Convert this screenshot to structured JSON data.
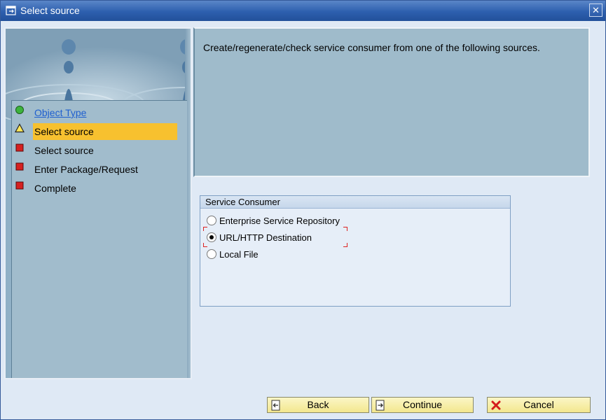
{
  "window": {
    "title": "Select source",
    "close_glyph": "✕"
  },
  "roadmap": {
    "steps": [
      {
        "label": "Object Type",
        "status": "done",
        "icon": "green-circle-icon"
      },
      {
        "label": "Select source",
        "status": "current",
        "icon": "yellow-triangle-icon"
      },
      {
        "label": "Select source",
        "status": "pending",
        "icon": "red-square-icon"
      },
      {
        "label": "Enter Package/Request",
        "status": "pending",
        "icon": "red-square-icon"
      },
      {
        "label": "Complete",
        "status": "pending",
        "icon": "red-square-icon"
      }
    ]
  },
  "description": {
    "text": "Create/regenerate/check service consumer from one of the following sources."
  },
  "service_consumer": {
    "title": "Service Consumer",
    "options": [
      {
        "label": "Enterprise Service Repository",
        "selected": false
      },
      {
        "label": "URL/HTTP Destination",
        "selected": true
      },
      {
        "label": "Local File",
        "selected": false
      }
    ]
  },
  "buttons": {
    "back": {
      "label": "Back",
      "icon": "back-icon"
    },
    "continue": {
      "label": "Continue",
      "icon": "continue-icon"
    },
    "cancel": {
      "label": "Cancel",
      "icon": "cancel-icon"
    }
  },
  "colors": {
    "title_bar": "#2d5fae",
    "active_step": "#f7c12f",
    "button": "#f3e78e",
    "link": "#1f5fcf"
  }
}
